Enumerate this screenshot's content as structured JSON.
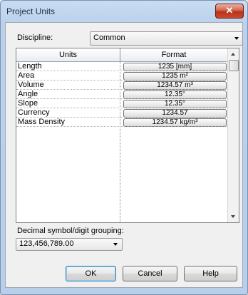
{
  "window": {
    "title": "Project Units",
    "close_symbol": "✕"
  },
  "discipline": {
    "label": "Discipline:",
    "value": "Common"
  },
  "table": {
    "columns": [
      "Units",
      "Format"
    ],
    "rows": [
      {
        "unit": "Length",
        "format": "1235 [mm]"
      },
      {
        "unit": "Area",
        "format": "1235 m²"
      },
      {
        "unit": "Volume",
        "format": "1234.57 m³"
      },
      {
        "unit": "Angle",
        "format": "12.35°"
      },
      {
        "unit": "Slope",
        "format": "12.35°"
      },
      {
        "unit": "Currency",
        "format": "1234.57"
      },
      {
        "unit": "Mass Density",
        "format": "1234.57 kg/m³"
      }
    ]
  },
  "grouping": {
    "label": "Decimal symbol/digit grouping:",
    "value": "123,456,789.00"
  },
  "buttons": {
    "ok": "OK",
    "cancel": "Cancel",
    "help": "Help"
  }
}
